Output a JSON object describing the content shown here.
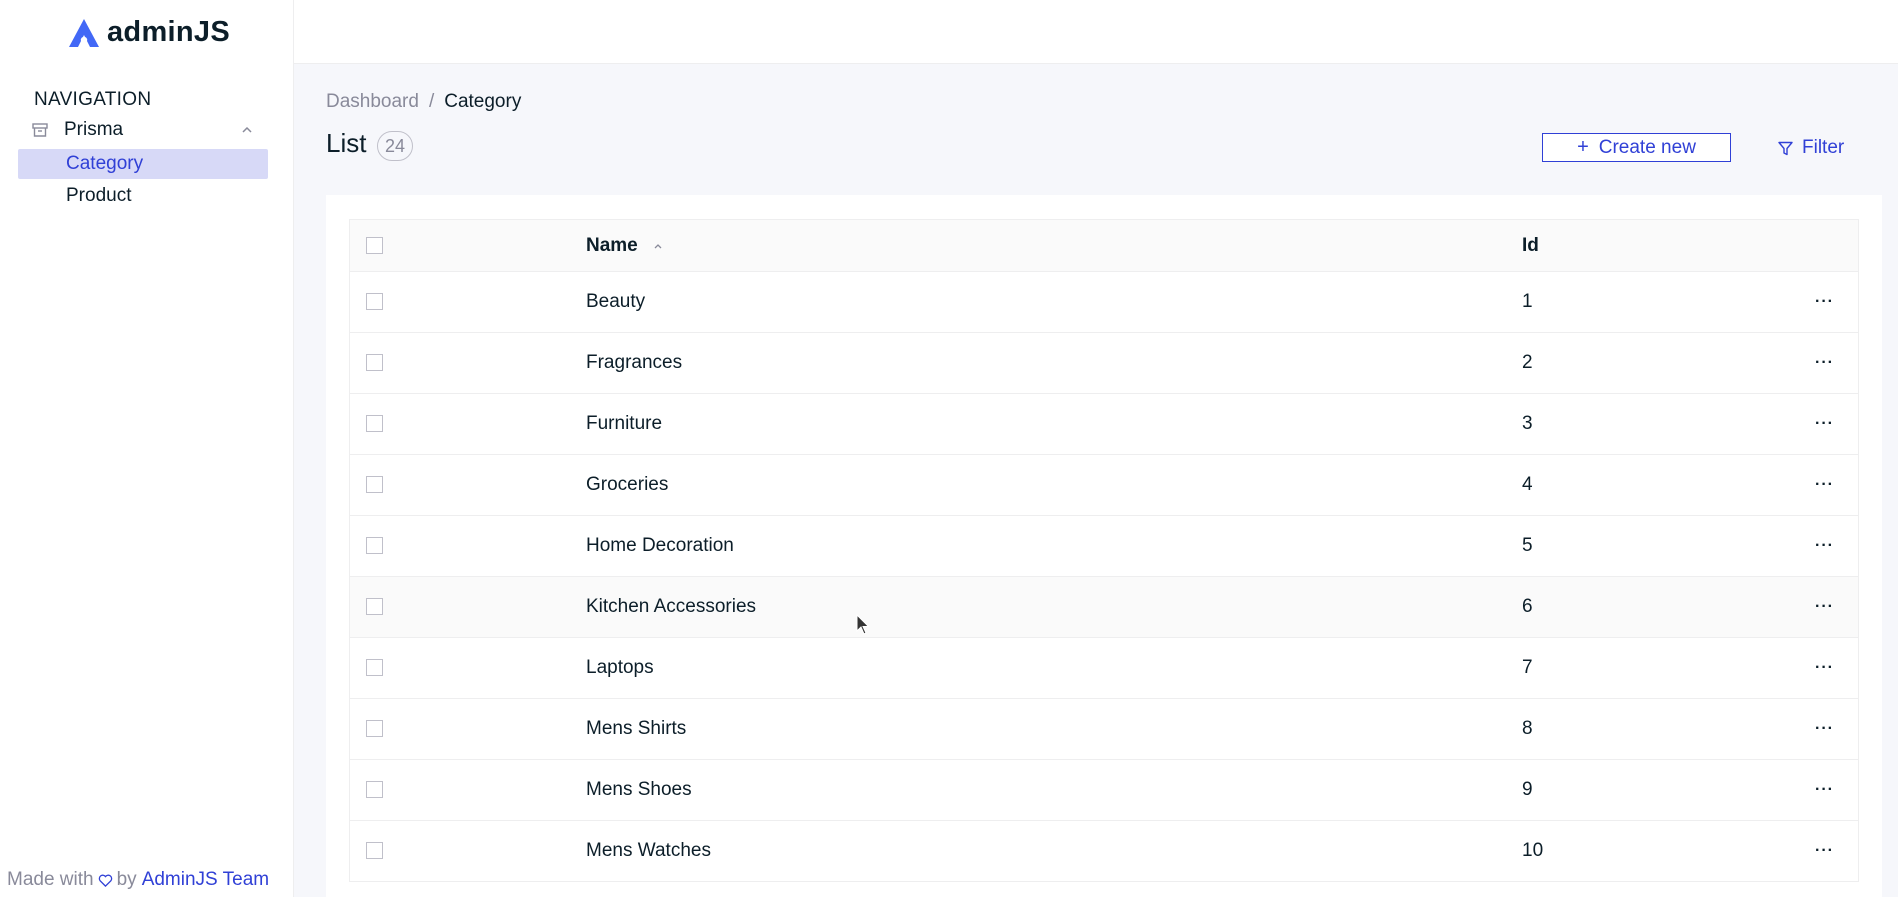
{
  "sidebar": {
    "logo_text": "adminJS",
    "nav_heading": "NAVIGATION",
    "group_label": "Prisma",
    "items": [
      {
        "label": "Category",
        "active": true
      },
      {
        "label": "Product",
        "active": false
      }
    ],
    "footer": {
      "made_with": "Made with",
      "by": "by",
      "team_link": "AdminJS Team"
    }
  },
  "breadcrumb": {
    "root": "Dashboard",
    "separator": "/",
    "current": "Category"
  },
  "page": {
    "title": "List",
    "count": "24"
  },
  "actions": {
    "create_label": "Create new",
    "create_icon": "+",
    "filter_label": "Filter"
  },
  "table": {
    "columns": {
      "name": "Name",
      "id": "Id"
    },
    "row_menu": "···",
    "rows": [
      {
        "name": "Beauty",
        "id": "1"
      },
      {
        "name": "Fragrances",
        "id": "2"
      },
      {
        "name": "Furniture",
        "id": "3"
      },
      {
        "name": "Groceries",
        "id": "4"
      },
      {
        "name": "Home Decoration",
        "id": "5"
      },
      {
        "name": "Kitchen Accessories",
        "id": "6"
      },
      {
        "name": "Laptops",
        "id": "7"
      },
      {
        "name": "Mens Shirts",
        "id": "8"
      },
      {
        "name": "Mens Shoes",
        "id": "9"
      },
      {
        "name": "Mens Watches",
        "id": "10"
      }
    ]
  },
  "colors": {
    "accent": "#3040d6",
    "active_bg": "#d7d9f7",
    "muted": "#898a9a"
  }
}
